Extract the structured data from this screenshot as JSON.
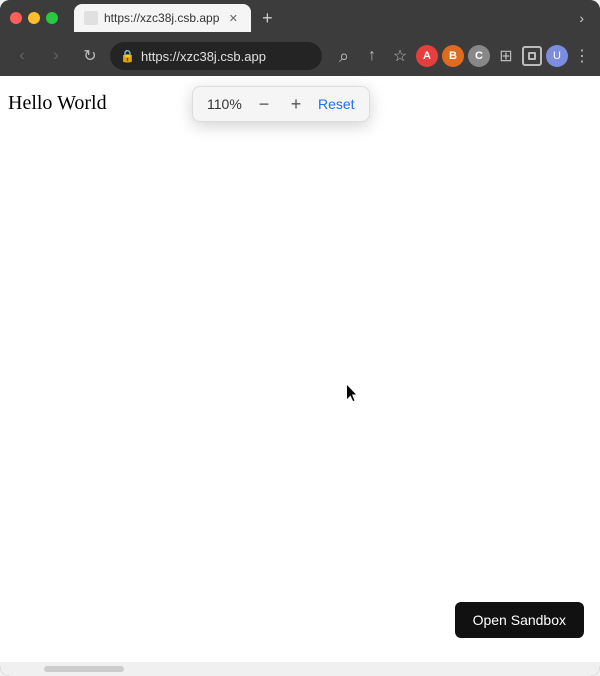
{
  "browser": {
    "url": "https://xzc38j.csb.app",
    "tab_title": "https://xzc38j.csb.app",
    "new_tab_label": "+",
    "chevron_label": "›"
  },
  "nav": {
    "back_label": "‹",
    "forward_label": "›",
    "reload_label": "↻"
  },
  "toolbar": {
    "search_icon_label": "⌕",
    "share_icon_label": "↑",
    "bookmark_icon_label": "☆",
    "extension1_letter": "A",
    "extension2_letter": "B",
    "extension3_letter": "C",
    "puzzle_icon": "⊞",
    "menu_label": "⋮"
  },
  "webpage": {
    "hello_world": "Hello World"
  },
  "zoom": {
    "percent": "110%",
    "minus_label": "−",
    "plus_label": "+",
    "reset_label": "Reset"
  },
  "sandbox": {
    "button_label": "Open Sandbox"
  }
}
